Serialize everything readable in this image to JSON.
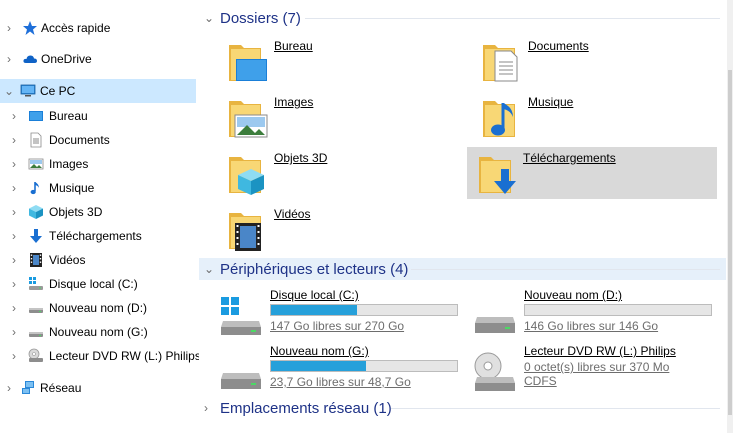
{
  "sidebar": {
    "items": [
      {
        "label": "Accès rapide"
      },
      {
        "label": "OneDrive"
      },
      {
        "label": "Ce PC"
      },
      {
        "label": "Bureau"
      },
      {
        "label": "Documents"
      },
      {
        "label": "Images"
      },
      {
        "label": "Musique"
      },
      {
        "label": "Objets 3D"
      },
      {
        "label": "Téléchargements"
      },
      {
        "label": "Vidéos"
      },
      {
        "label": "Disque local (C:)"
      },
      {
        "label": "Nouveau nom (D:)"
      },
      {
        "label": "Nouveau nom (G:)"
      },
      {
        "label": "Lecteur DVD RW (L:) Philips"
      },
      {
        "label": "Réseau"
      }
    ]
  },
  "groups": {
    "folders": {
      "title": "Dossiers (7)"
    },
    "devices": {
      "title": "Périphériques et lecteurs (4)"
    },
    "network": {
      "title": "Emplacements réseau (1)"
    }
  },
  "folders": [
    {
      "name": "Bureau"
    },
    {
      "name": "Documents"
    },
    {
      "name": "Images"
    },
    {
      "name": "Musique"
    },
    {
      "name": "Objets 3D"
    },
    {
      "name": "Téléchargements"
    },
    {
      "name": "Vidéos"
    }
  ],
  "drives": [
    {
      "name": "Disque local (C:)",
      "free": "147 Go libres sur 270 Go",
      "used_fraction": 0.46
    },
    {
      "name": "Nouveau nom (D:)",
      "free": "146 Go libres sur 146 Go",
      "used_fraction": 0.0
    },
    {
      "name": "Nouveau nom (G:)",
      "free": "23,7 Go libres sur 48,7 Go",
      "used_fraction": 0.51
    },
    {
      "name": "Lecteur DVD RW (L:) Philips",
      "free": "0 octet(s) libres sur 370 Mo",
      "filesystem": "CDFS"
    }
  ],
  "colors": {
    "selection": "#cce8ff",
    "group_title": "#1e3287",
    "drive_bar": "#26a0da",
    "hover": "#d9d9d9"
  }
}
